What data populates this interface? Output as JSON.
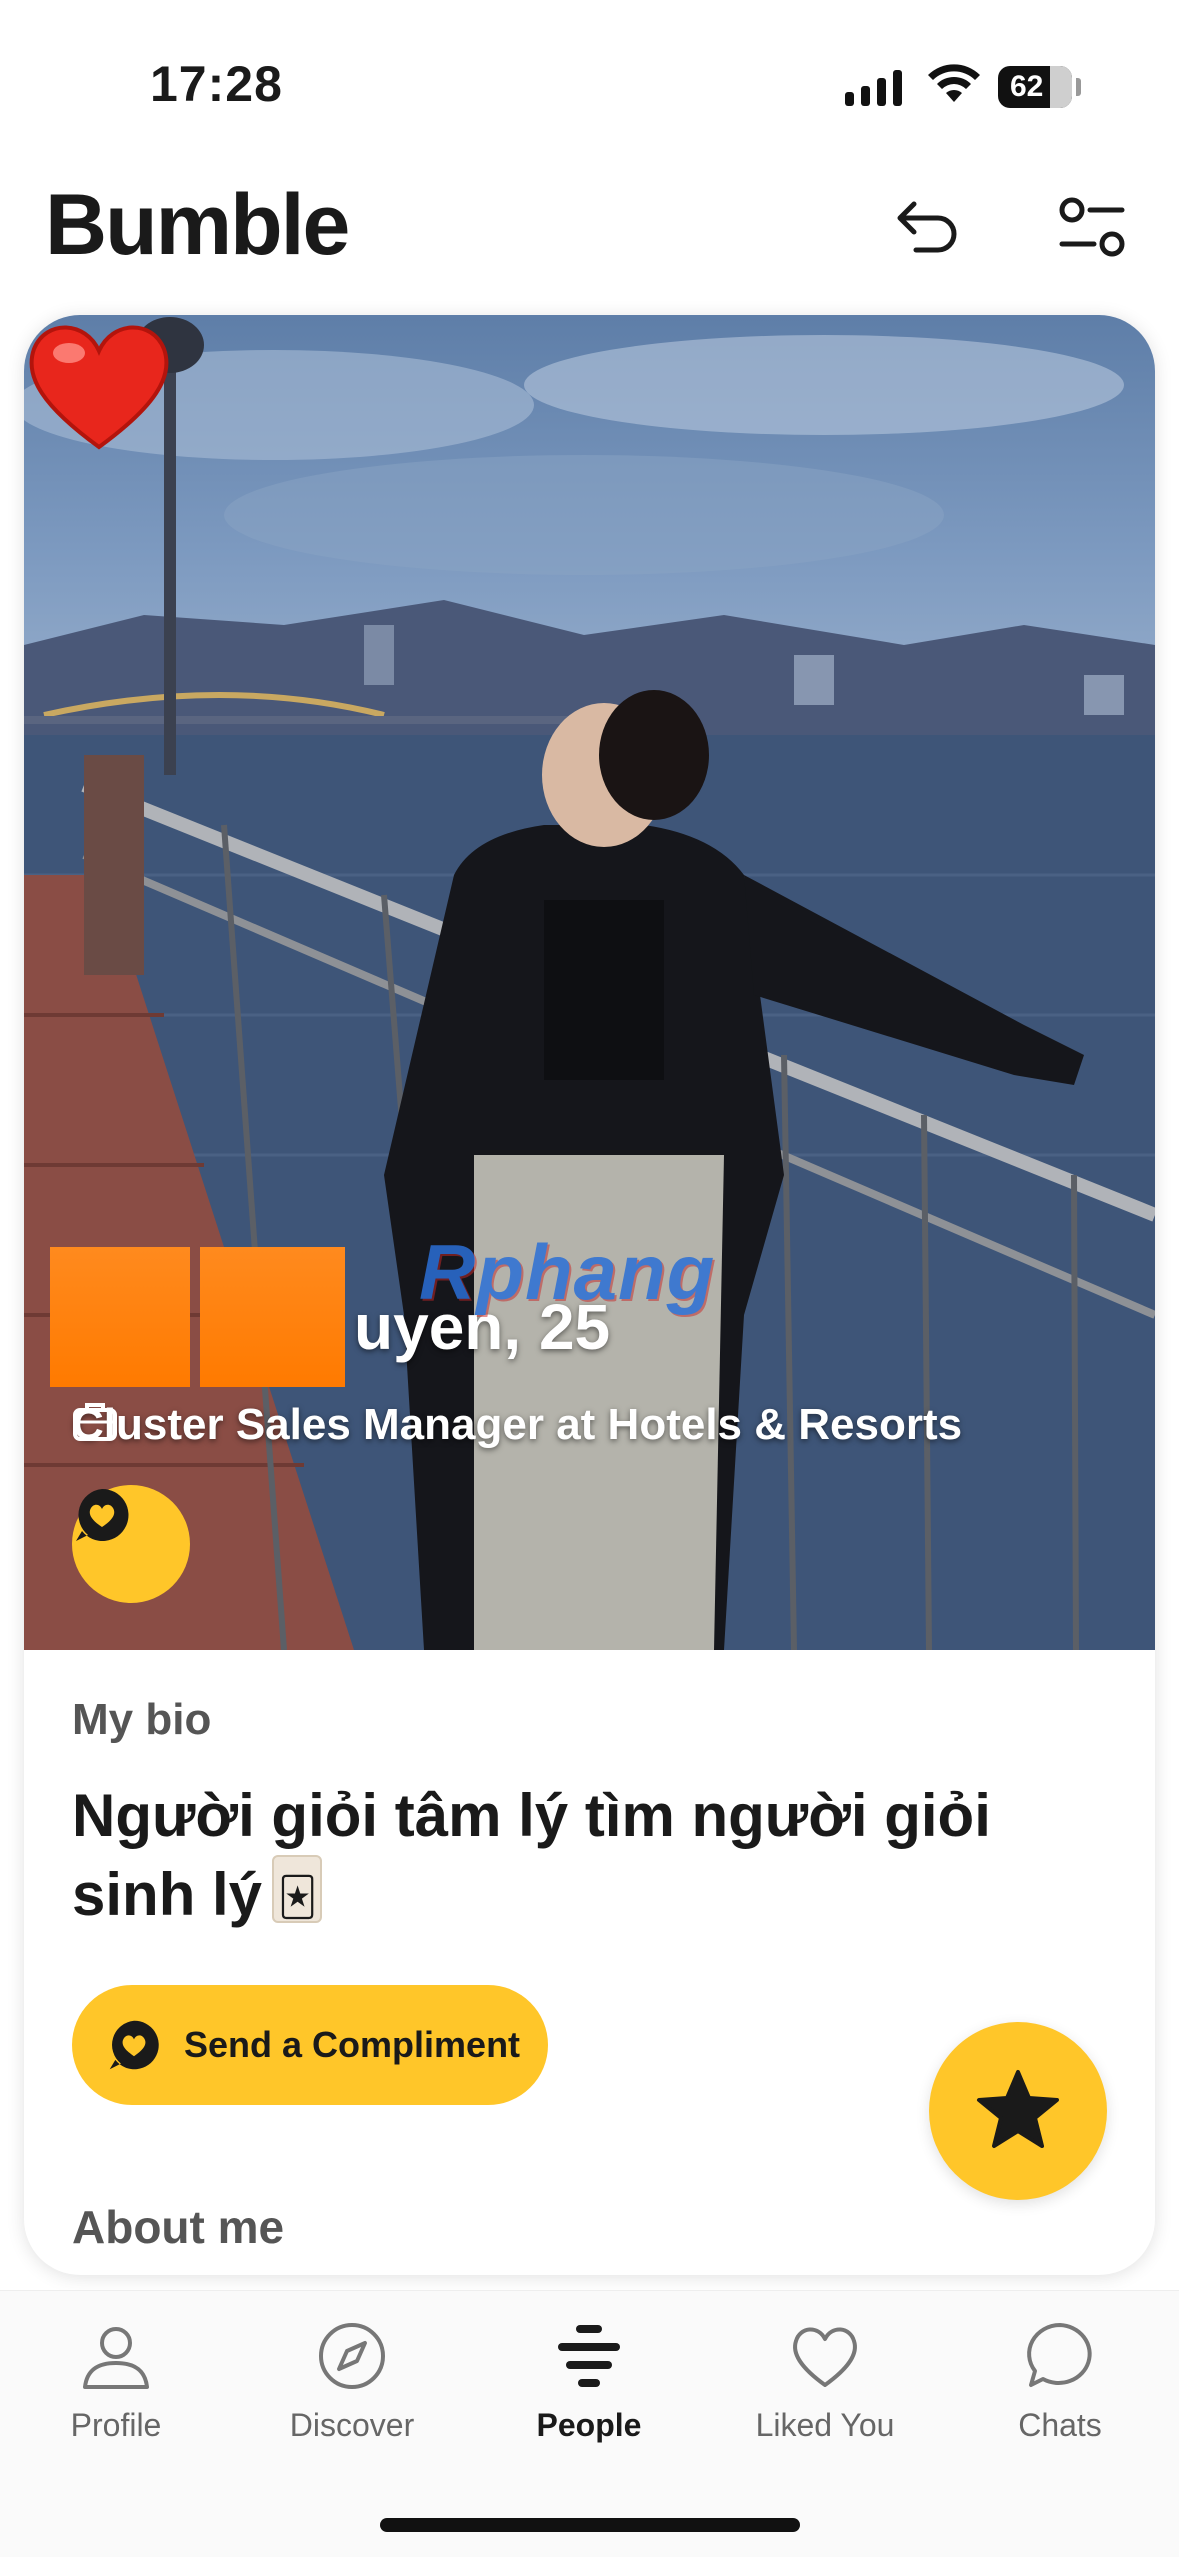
{
  "status_bar": {
    "time": "17:28",
    "battery": "62",
    "icons": [
      "signal-icon",
      "wifi-icon",
      "battery-icon"
    ]
  },
  "header": {
    "brand": "Bumble",
    "undo_icon": "undo-icon",
    "filter_icon": "filter-icon"
  },
  "profile": {
    "name_visible": "uyen, 25",
    "job": "Cluster Sales Manager at Hotels & Resorts",
    "watermark": "Rphang",
    "bio_label": "My bio",
    "bio_text": "Người giỏi tâm lý tìm người giỏi sinh lý",
    "compliment_button": "Send a Compliment",
    "about_label": "About me"
  },
  "nav": {
    "items": [
      {
        "label": "Profile",
        "icon": "person-icon"
      },
      {
        "label": "Discover",
        "icon": "compass-icon"
      },
      {
        "label": "People",
        "icon": "people-stack-icon",
        "active": true
      },
      {
        "label": "Liked You",
        "icon": "heart-icon"
      },
      {
        "label": "Chats",
        "icon": "chat-bubble-icon"
      }
    ]
  },
  "colors": {
    "accent": "#ffc629",
    "redaction": "#ff7a00",
    "text": "#1a1a1a"
  }
}
